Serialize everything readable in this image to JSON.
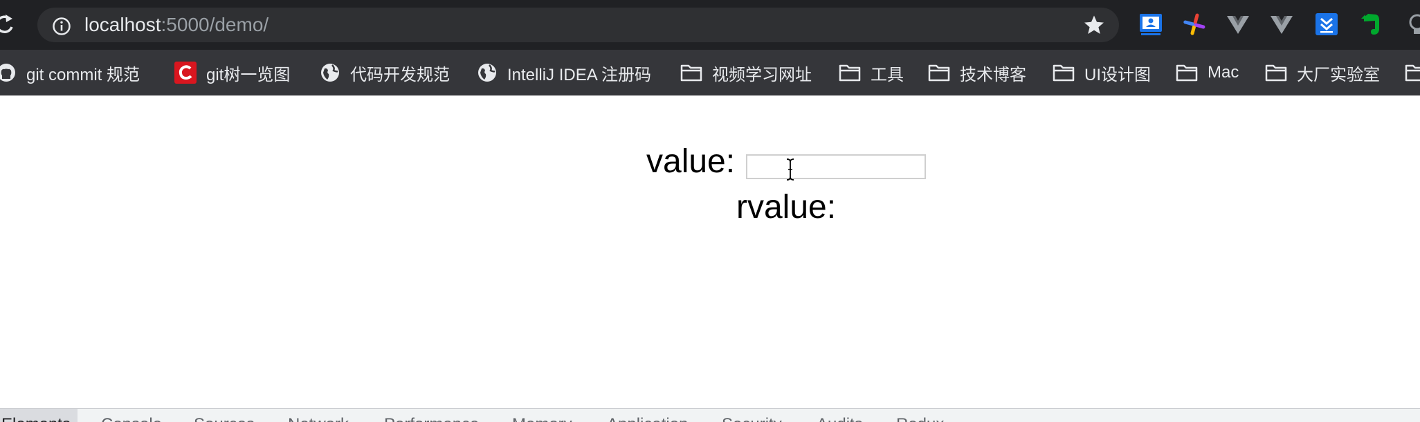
{
  "browser": {
    "url_host": "localhost",
    "url_path": ":5000/demo/"
  },
  "extensions": [
    {
      "icon": "meeting-screen-icon",
      "color": "#1a73e8"
    },
    {
      "icon": "pinwheel-icon",
      "color": "#e94235"
    },
    {
      "icon": "vue-devtools-icon",
      "color": "#9aa0a6"
    },
    {
      "icon": "vue-devtools-icon",
      "color": "#9aa0a6"
    },
    {
      "icon": "download-arrows-icon",
      "color": "#1a73e8"
    },
    {
      "icon": "evernote-icon",
      "color": "#00a82d"
    },
    {
      "icon": "bulb-icon",
      "color": "#9aa0a6"
    }
  ],
  "bookmarks": [
    {
      "label": "git commit 规范",
      "icon": "github-icon"
    },
    {
      "label": "git树一览图",
      "icon": "c-logo-icon"
    },
    {
      "label": "代码开发规范",
      "icon": "globe-icon"
    },
    {
      "label": "IntelliJ IDEA 注册码",
      "icon": "globe-icon"
    },
    {
      "label": "视频学习网址",
      "icon": "folder-icon"
    },
    {
      "label": "工具",
      "icon": "folder-icon"
    },
    {
      "label": "技术博客",
      "icon": "folder-icon"
    },
    {
      "label": "UI设计图",
      "icon": "folder-icon"
    },
    {
      "label": "Mac",
      "icon": "folder-icon"
    },
    {
      "label": "大厂实验室",
      "icon": "folder-icon"
    }
  ],
  "page": {
    "value_label": "value:",
    "value_input": "",
    "rvalue_label": "rvalue:"
  },
  "devtools": {
    "tabs": [
      "Elements",
      "Console",
      "Sources",
      "Network",
      "Performance",
      "Memory",
      "Application",
      "Security",
      "Audits",
      "Redux"
    ]
  },
  "colors": {
    "toolbar_bg": "#202124",
    "bookmarks_bg": "#35363a",
    "text_light": "#e8eaed"
  }
}
